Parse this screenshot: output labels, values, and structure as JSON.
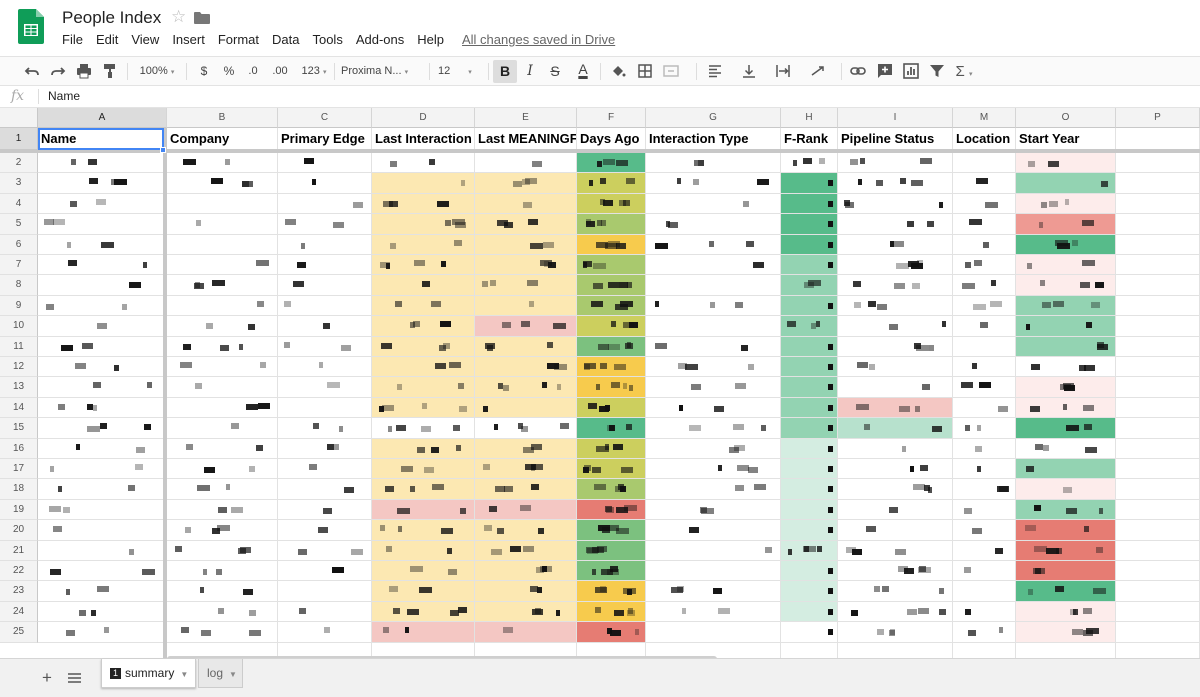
{
  "app": {
    "doc_title": "People Index",
    "star_icon": "☆",
    "saved_status": "All changes saved in Drive"
  },
  "menu": [
    "File",
    "Edit",
    "View",
    "Insert",
    "Format",
    "Data",
    "Tools",
    "Add-ons",
    "Help"
  ],
  "toolbar": {
    "zoom": "100%",
    "currency": "$",
    "percent": "%",
    "dec_decrease": ".0",
    "dec_increase": ".00",
    "more_formats": "123",
    "font": "Proxima N...",
    "font_size": "12",
    "bold": "B",
    "italic": "I",
    "strike": "S",
    "text_color": "A",
    "sum": "Σ"
  },
  "formula_bar": {
    "label": "fx",
    "value": "Name"
  },
  "columns": [
    {
      "letter": "A",
      "header": "Name"
    },
    {
      "letter": "B",
      "header": "Company"
    },
    {
      "letter": "C",
      "header": "Primary Edge"
    },
    {
      "letter": "D",
      "header": "Last Interaction"
    },
    {
      "letter": "E",
      "header": "Last MEANINGF"
    },
    {
      "letter": "F",
      "header": "Days Ago"
    },
    {
      "letter": "G",
      "header": "Interaction Type"
    },
    {
      "letter": "H",
      "header": "F-Rank"
    },
    {
      "letter": "I",
      "header": "Pipeline Status"
    },
    {
      "letter": "M",
      "header": "Location"
    },
    {
      "letter": "O",
      "header": "Start Year"
    },
    {
      "letter": "P",
      "header": ""
    }
  ],
  "row_numbers": [
    "1",
    "2",
    "3",
    "4",
    "5",
    "6",
    "7",
    "8",
    "9",
    "10",
    "11",
    "12",
    "13",
    "14",
    "15",
    "16",
    "17",
    "18",
    "19",
    "20",
    "21",
    "22",
    "23",
    "24",
    "25"
  ],
  "colors": {
    "accent_blue": "#4285f4",
    "sheets_green": "#0f9d58",
    "interaction_yellow": "#fce8b2",
    "stale_red": "#f4c7c3"
  },
  "sheets": {
    "active": {
      "index": "1",
      "label": "summary"
    },
    "other": {
      "label": "log"
    }
  }
}
